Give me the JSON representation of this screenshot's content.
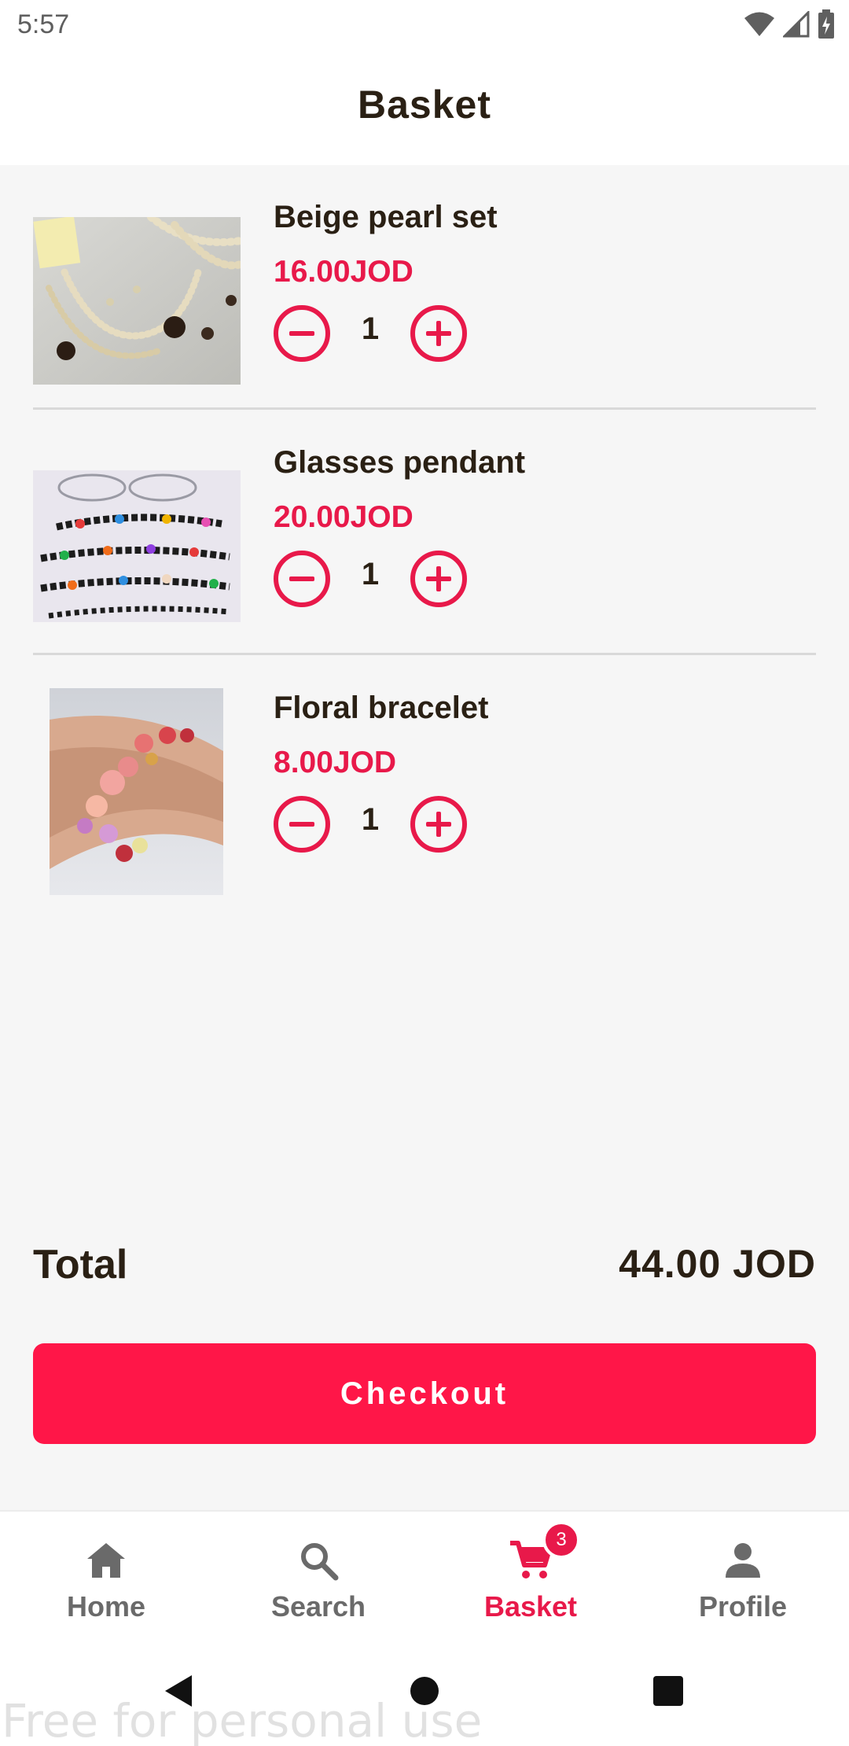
{
  "status_bar": {
    "time": "5:57"
  },
  "header": {
    "title": "Basket"
  },
  "items": [
    {
      "name": "Beige pearl set",
      "price": "16.00JOD",
      "quantity": "1"
    },
    {
      "name": "Glasses pendant",
      "price": "20.00JOD",
      "quantity": "1"
    },
    {
      "name": "Floral bracelet",
      "price": "8.00JOD",
      "quantity": "1"
    }
  ],
  "summary": {
    "total_label": "Total",
    "total_value": "44.00 JOD",
    "checkout_label": "Checkout"
  },
  "bottom_nav": {
    "items": [
      {
        "label": "Home",
        "icon": "home-icon",
        "active": false
      },
      {
        "label": "Search",
        "icon": "search-icon",
        "active": false
      },
      {
        "label": "Basket",
        "icon": "cart-icon",
        "active": true,
        "badge": "3"
      },
      {
        "label": "Profile",
        "icon": "person-icon",
        "active": false
      }
    ]
  },
  "watermark": "Free for personal use",
  "colors": {
    "accent": "#e8194a",
    "button": "#ff1648",
    "text": "#2a2014",
    "inactive": "#6a6a6a",
    "background": "#f6f6f6"
  }
}
